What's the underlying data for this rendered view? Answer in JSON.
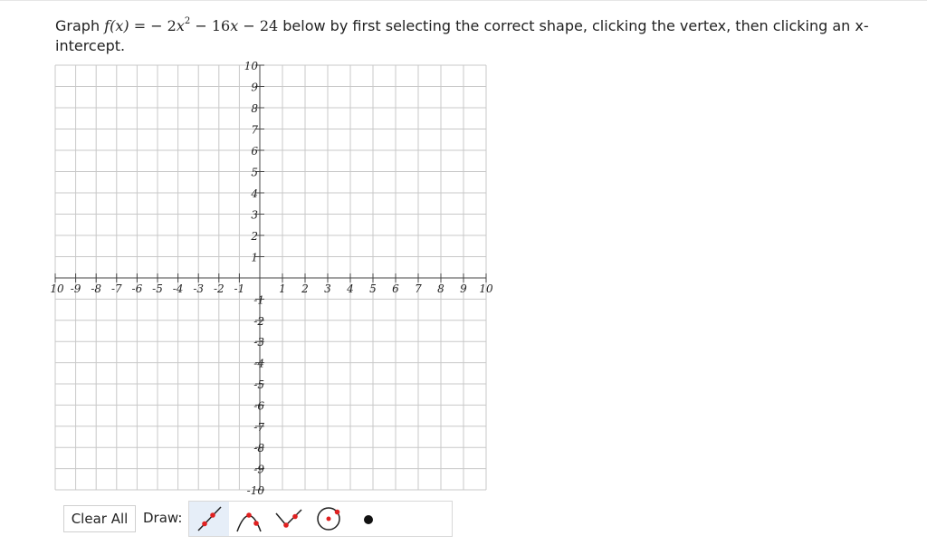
{
  "question": {
    "prefix": "Graph",
    "func": "f(x)",
    "eq": " = ",
    "expr_a": "− 2",
    "expr_exp": "2",
    "expr_b": " − 16",
    "expr_c": " − 24",
    "suffix": "below by first selecting the correct shape, clicking the vertex, then clicking an x-intercept."
  },
  "graph": {
    "x_range": [
      -10,
      10
    ],
    "y_range": [
      -10,
      10
    ],
    "x_tick_labels": [
      "10",
      "-9",
      "-8",
      "-7",
      "-6",
      "-5",
      "-4",
      "-3",
      "-2",
      "-1",
      "1",
      "2",
      "3",
      "4",
      "5",
      "6",
      "7",
      "8",
      "9",
      "10"
    ],
    "y_tick_labels_pos": [
      "10",
      "9",
      "8",
      "7",
      "6",
      "5",
      "4",
      "3",
      "2",
      "1"
    ],
    "y_tick_labels_neg": [
      "-1",
      "-2",
      "-3",
      "-4",
      "-5",
      "-6",
      "-7",
      "-8",
      "-9",
      "-10"
    ],
    "grid": true,
    "colors": {
      "grid": "#c8c8c8",
      "axis": "#444444",
      "point": "#e02020"
    }
  },
  "toolbar": {
    "clear_label": "Clear All",
    "draw_label": "Draw:",
    "tools": [
      {
        "icon": "line-tool-icon",
        "selected": true
      },
      {
        "icon": "parabola-down-icon",
        "selected": false
      },
      {
        "icon": "absolute-value-icon",
        "selected": false
      },
      {
        "icon": "circle-tool-icon",
        "selected": false
      },
      {
        "icon": "point-tool-icon",
        "selected": false
      }
    ]
  }
}
